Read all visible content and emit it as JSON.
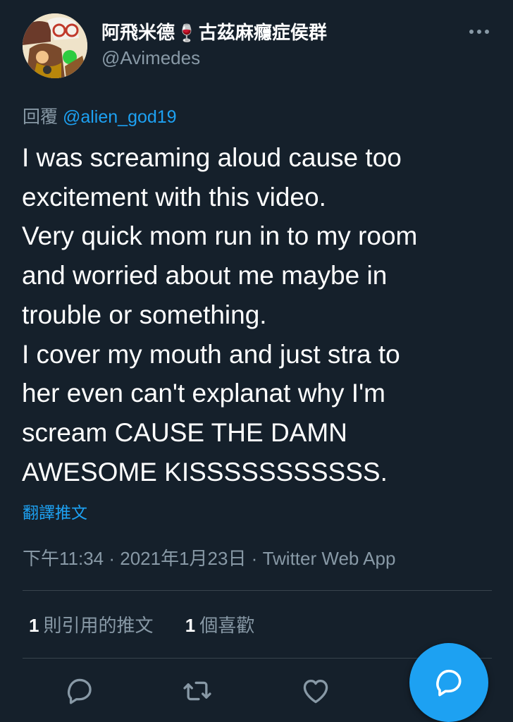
{
  "tweet": {
    "author": {
      "display_name_prefix": "阿飛米德",
      "display_name_emoji": "🍷",
      "display_name_suffix": "古茲麻癮症侯群",
      "handle": "@Avimedes"
    },
    "reply_to": {
      "label": "回覆",
      "mention": "@alien_god19"
    },
    "text_lines": [
      "I was screaming aloud cause too",
      "excitement with this video.",
      "Very quick mom run in to my room",
      "and worried about me maybe in",
      "trouble or something.",
      "I cover my mouth and just stra to",
      "her even can't explanat why I'm",
      "scream CAUSE THE DAMN",
      "AWESOME KISSSSSSSSSSS."
    ],
    "translate_label": "翻譯推文",
    "timestamp": "下午11:34 · 2021年1月23日 · ",
    "source": "Twitter Web App",
    "stats": {
      "quotes_count": "1",
      "quotes_label": "則引用的推文",
      "likes_count": "1",
      "likes_label": "個喜歡"
    },
    "actions": {
      "reply_icon": "reply-icon",
      "retweet_icon": "retweet-icon",
      "like_icon": "heart-icon",
      "fab_icon": "compose-reply-icon"
    }
  },
  "colors": {
    "background": "#15202b",
    "text_primary": "#ffffff",
    "text_secondary": "#8899a6",
    "accent": "#1da1f2",
    "divider": "#38444d"
  }
}
